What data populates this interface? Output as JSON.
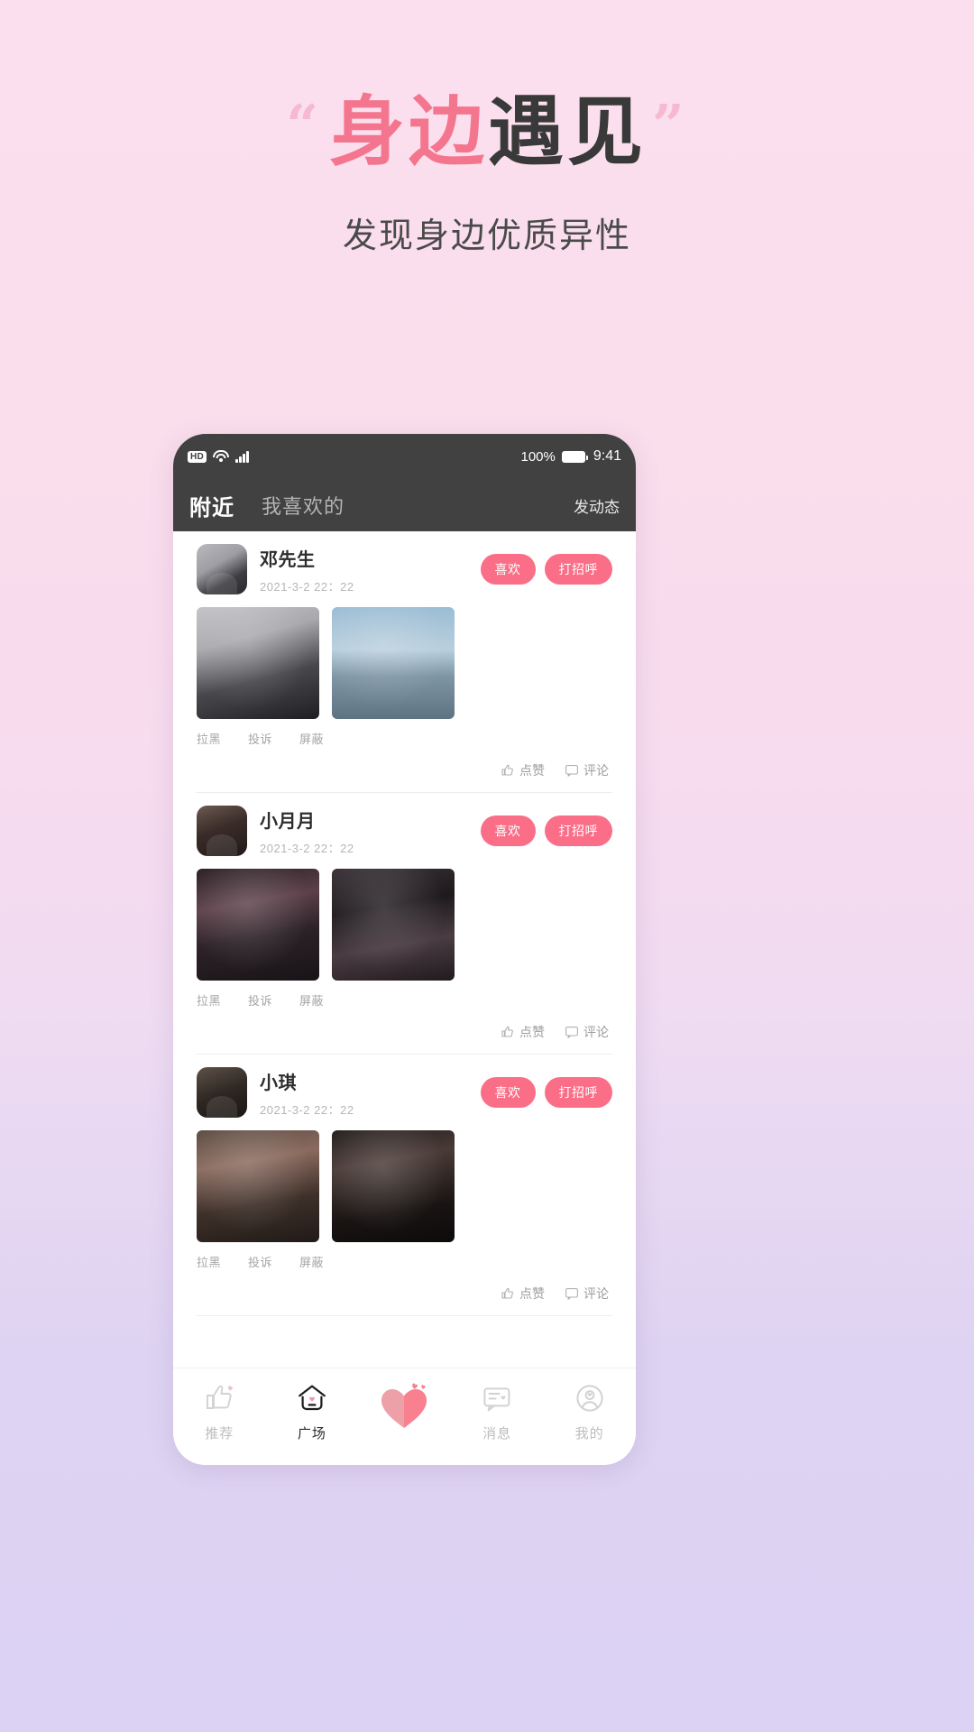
{
  "hero": {
    "quote_open": "“",
    "quote_close": "”",
    "title_pink": "身边",
    "title_dark": "遇见",
    "subtitle": "发现身边优质异性",
    "accent_color": "#f4768e",
    "dark_color": "#393939",
    "quote_color": "#f6b9cf"
  },
  "statusbar": {
    "hd": "HD",
    "battery_percent": "100%",
    "time": "9:41",
    "bar_color": "#414141"
  },
  "navbar": {
    "tabs": [
      {
        "label": "附近",
        "active": true
      },
      {
        "label": "我喜欢的",
        "active": false
      }
    ],
    "action": "发动态"
  },
  "feed": {
    "button_labels": {
      "like": "喜欢",
      "greet": "打招呼"
    },
    "link_labels": [
      "拉黑",
      "投诉",
      "屏蔽"
    ],
    "footer_labels": {
      "praise": "点赞",
      "comment": "评论"
    },
    "pill_color": "#fb6e87",
    "posts": [
      {
        "name": "邓先生",
        "time": "2021-3-2  22：22",
        "avatar_class": "av-p1",
        "photos": [
          "ph-1",
          "ph-2"
        ]
      },
      {
        "name": "小月月",
        "time": "2021-3-2  22：22",
        "avatar_class": "av-p2",
        "photos": [
          "ph-3",
          "ph-4"
        ]
      },
      {
        "name": "小琪",
        "time": "2021-3-2  22：22",
        "avatar_class": "av-p3",
        "photos": [
          "ph-5",
          "ph-6"
        ]
      }
    ]
  },
  "tabbar": {
    "items": [
      {
        "label": "推荐",
        "icon": "thumbs-up-heart-icon",
        "active": false
      },
      {
        "label": "广场",
        "icon": "home-heart-icon",
        "active": true
      },
      {
        "label": "消息",
        "icon": "chat-heart-icon",
        "active": false
      },
      {
        "label": "我的",
        "icon": "profile-heart-icon",
        "active": false
      }
    ],
    "center_icon": "heart-fab-icon"
  }
}
